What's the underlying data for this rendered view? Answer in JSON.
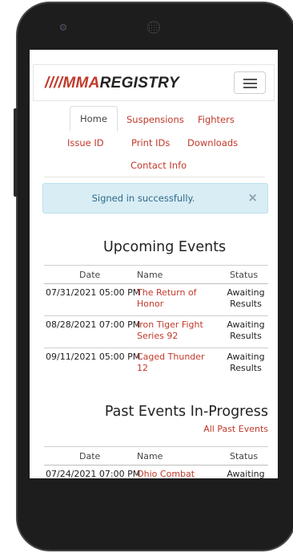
{
  "brand": {
    "slashes": "////",
    "mma": "MMA",
    "registry": "REGISTRY"
  },
  "tabs": [
    "Home",
    "Suspensions",
    "Fighters",
    "Issue ID",
    "Print IDs",
    "Downloads",
    "Contact Info"
  ],
  "alert": {
    "message": "Signed in successfully.",
    "close": "×"
  },
  "upcoming": {
    "title": "Upcoming Events",
    "headers": [
      "Date",
      "Name",
      "Status"
    ],
    "rows": [
      {
        "date": "07/31/2021 05:00 PM",
        "name": "The Return of Honor",
        "status": "Awaiting Results"
      },
      {
        "date": "08/28/2021 07:00 PM",
        "name": "Iron Tiger Fight Series 92",
        "status": "Awaiting Results"
      },
      {
        "date": "09/11/2021 05:00 PM",
        "name": "Caged Thunder 12",
        "status": "Awaiting Results"
      }
    ]
  },
  "past": {
    "title": "Past Events In-Progress",
    "all_link": "All Past Events",
    "headers": [
      "Date",
      "Name",
      "Status"
    ],
    "rows": [
      {
        "date": "07/24/2021 07:00 PM",
        "name": "Ohio Combat",
        "status": "Awaiting"
      }
    ]
  },
  "colors": {
    "brand_red": "#c0392b",
    "alert_bg": "#d9edf5",
    "alert_text": "#2d6a8a"
  }
}
